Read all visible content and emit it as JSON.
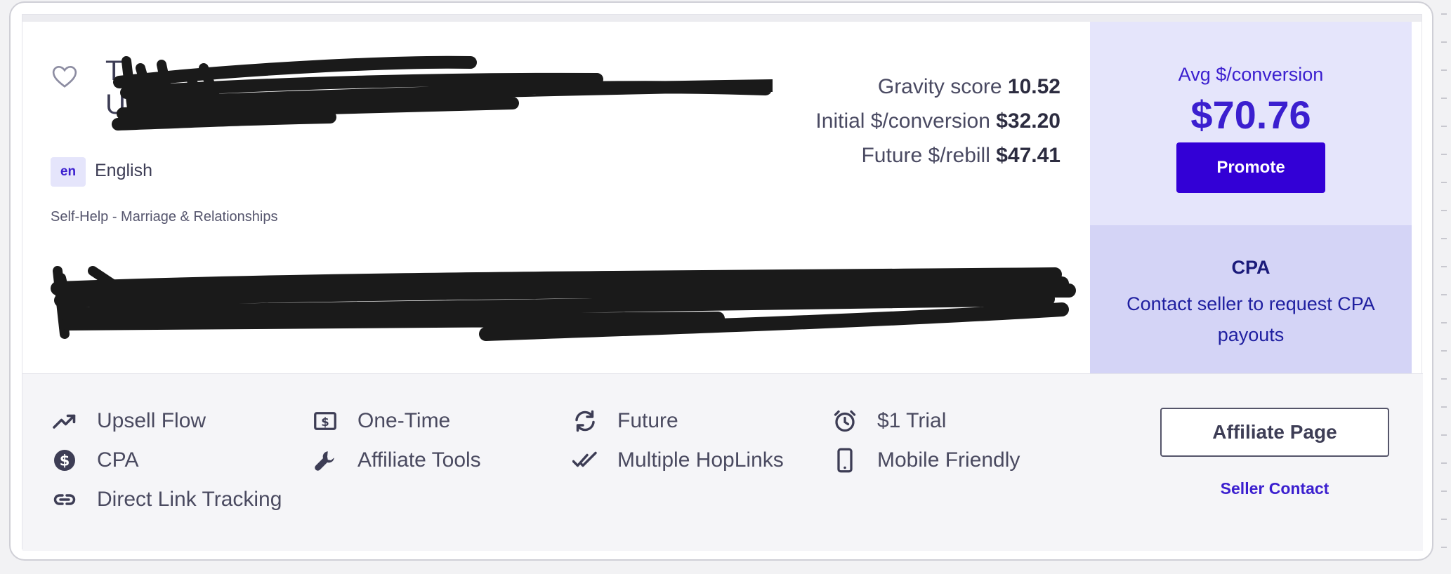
{
  "product": {
    "title_visible": "T",
    "subtitle_visible": "U",
    "language_code": "en",
    "language": "English",
    "category": "Self-Help - Marriage & Relationships"
  },
  "stats": {
    "gravity_label": "Gravity score",
    "gravity_value": "10.52",
    "initial_label": "Initial $/conversion",
    "initial_value": "$32.20",
    "future_label": "Future $/rebill",
    "future_value": "$47.41"
  },
  "summary": {
    "avg_label": "Avg $/conversion",
    "avg_value": "$70.76",
    "promote_label": "Promote"
  },
  "cpa": {
    "title": "CPA",
    "text": "Contact seller to request CPA payouts"
  },
  "features": [
    {
      "label": "Upsell Flow",
      "icon": "trending-up-icon"
    },
    {
      "label": "One-Time",
      "icon": "dollar-bill-icon"
    },
    {
      "label": "Future",
      "icon": "refresh-icon"
    },
    {
      "label": "$1 Trial",
      "icon": "alarm-clock-icon"
    },
    {
      "label": "CPA",
      "icon": "dollar-circle-icon"
    },
    {
      "label": "Affiliate Tools",
      "icon": "wrench-icon"
    },
    {
      "label": "Multiple HopLinks",
      "icon": "double-check-icon"
    },
    {
      "label": "Mobile Friendly",
      "icon": "mobile-phone-icon"
    },
    {
      "label": "Direct Link Tracking",
      "icon": "link-icon"
    }
  ],
  "actions": {
    "affiliate_page": "Affiliate Page",
    "seller_contact": "Seller Contact"
  },
  "colors": {
    "brand": "#3300d6",
    "panel_light": "#e5e5fb",
    "panel_mid": "#d4d4f6",
    "redaction": "#1a1a1a"
  }
}
